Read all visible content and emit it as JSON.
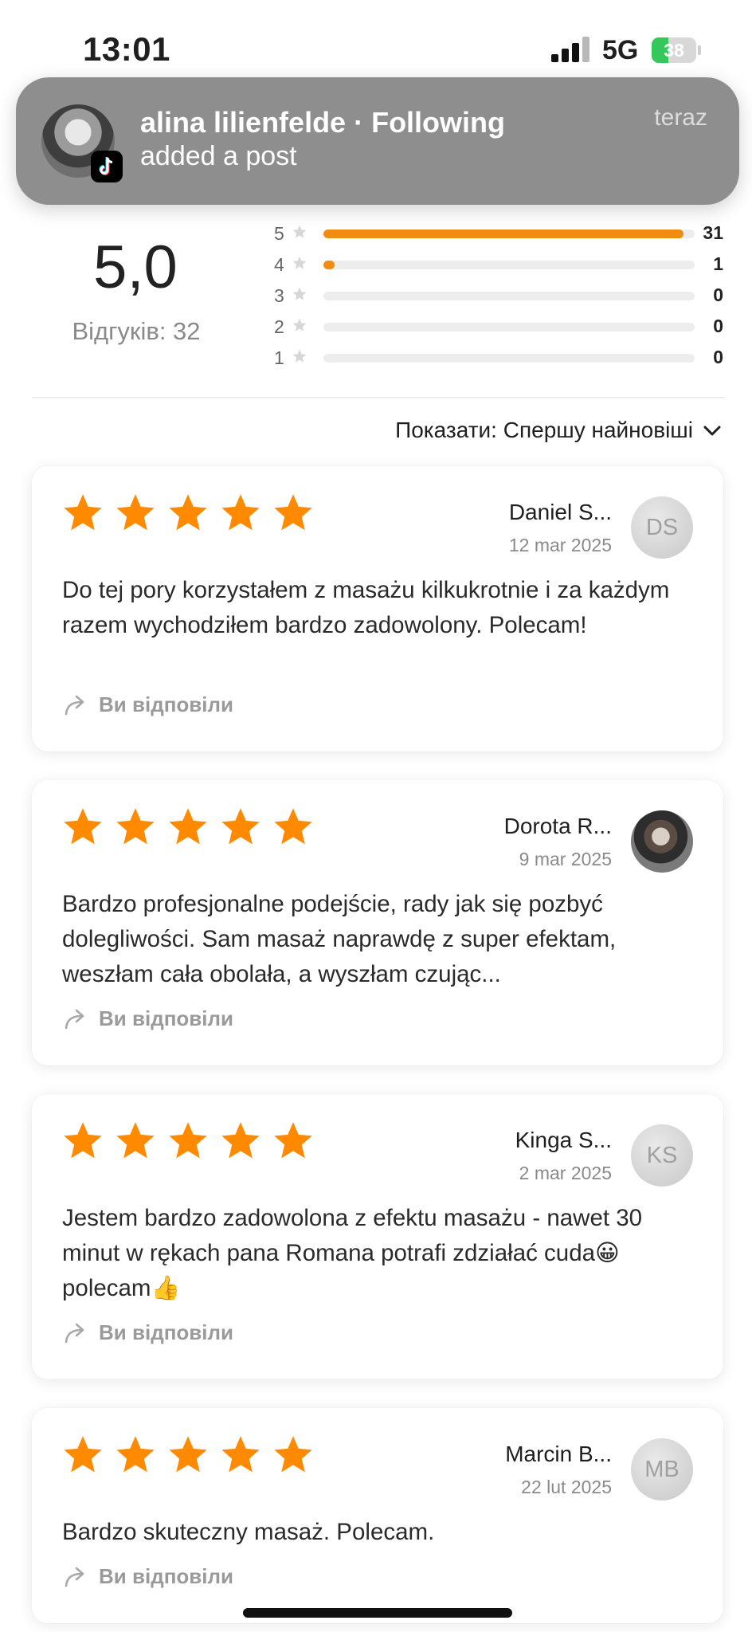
{
  "status_bar": {
    "time": "13:01",
    "network": "5G",
    "battery": "38",
    "battery_level": 0.38
  },
  "notification": {
    "title": "alina lilienfelde · Following",
    "body": "added a post",
    "time": "teraz"
  },
  "summary": {
    "rating": "5,0",
    "review_count_label": "Відгуків: 32",
    "distribution": [
      {
        "stars": "5",
        "count": "31",
        "fraction": 0.97
      },
      {
        "stars": "4",
        "count": "1",
        "fraction": 0.03
      },
      {
        "stars": "3",
        "count": "0",
        "fraction": 0
      },
      {
        "stars": "2",
        "count": "0",
        "fraction": 0
      },
      {
        "stars": "1",
        "count": "0",
        "fraction": 0
      }
    ]
  },
  "sort": {
    "label": "Показати: Спершу найновіші"
  },
  "reviews": [
    {
      "name": "Daniel S...",
      "date": "12 mar 2025",
      "initials": "DS",
      "text": "Do tej pory korzystałem z masażu kilkukrotnie i za każdym razem wychodziłem bardzo zadowolony. Polecam!",
      "reply": "Ви відповіли"
    },
    {
      "name": "Dorota R...",
      "date": "9 mar 2025",
      "initials": "",
      "text": "Bardzo profesjonalne podejście, rady jak się pozbyć dolegliwości. Sam masaż naprawdę z super efektam, weszłam cała obolała, a wyszłam czując...",
      "reply": "Ви відповіли"
    },
    {
      "name": "Kinga S...",
      "date": "2 mar 2025",
      "initials": "KS",
      "text": "Jestem bardzo zadowolona z efektu masażu - nawet 30 minut w rękach pana Romana potrafi zdziałać cuda😀 polecam👍",
      "reply": "Ви відповіли"
    },
    {
      "name": "Marcin B...",
      "date": "22 lut 2025",
      "initials": "MB",
      "text": "Bardzo skuteczny masaż. Polecam.",
      "reply": "Ви відповіли"
    }
  ],
  "colors": {
    "accent": "#f08c12",
    "star": "#ff8a00",
    "notification_bg": "#8e8e8e"
  }
}
